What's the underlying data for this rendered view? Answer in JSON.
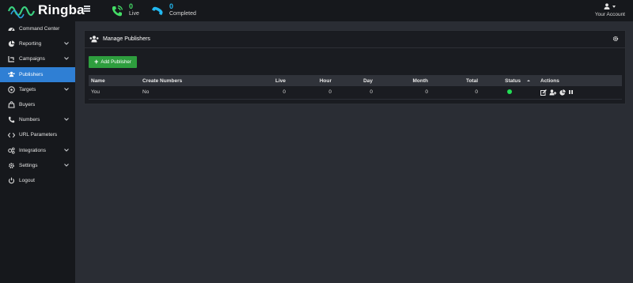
{
  "app": {
    "brand": "Ringba",
    "brand_color": "#3ad07f",
    "accent": "#2f7fd4"
  },
  "topbar": {
    "stats": [
      {
        "value": "0",
        "label": "Live",
        "icon": "phone-live-icon",
        "color": "#44dd66"
      },
      {
        "value": "0",
        "label": "Completed",
        "icon": "phone-completed-icon",
        "color": "#22b8f0"
      }
    ],
    "account_label": "Your Account"
  },
  "sidebar": {
    "items": [
      {
        "label": "Command Center",
        "icon": "dashboard-icon",
        "has_chevron": false,
        "active": false
      },
      {
        "label": "Reporting",
        "icon": "chart-icon",
        "has_chevron": true,
        "active": false
      },
      {
        "label": "Campaigns",
        "icon": "campaign-icon",
        "has_chevron": true,
        "active": false
      },
      {
        "label": "Publishers",
        "icon": "users-icon",
        "has_chevron": false,
        "active": true
      },
      {
        "label": "Targets",
        "icon": "target-icon",
        "has_chevron": true,
        "active": false
      },
      {
        "label": "Buyers",
        "icon": "buyers-icon",
        "has_chevron": false,
        "active": false
      },
      {
        "label": "Numbers",
        "icon": "phone-icon",
        "has_chevron": true,
        "active": false
      },
      {
        "label": "URL Parameters",
        "icon": "code-icon",
        "has_chevron": false,
        "active": false
      },
      {
        "label": "Integrations",
        "icon": "integrations-icon",
        "has_chevron": true,
        "active": false
      },
      {
        "label": "Settings",
        "icon": "gear-icon",
        "has_chevron": true,
        "active": false
      },
      {
        "label": "Logout",
        "icon": "power-icon",
        "has_chevron": false,
        "active": false
      }
    ]
  },
  "panel": {
    "title": "Manage Publishers",
    "add_button": "Add Publisher",
    "columns": [
      "Name",
      "Create Numbers",
      "Live",
      "Hour",
      "Day",
      "Month",
      "Total",
      "Status",
      "Actions"
    ],
    "rows": [
      {
        "name": "You",
        "create_numbers": "No",
        "live": "0",
        "hour": "0",
        "day": "0",
        "month": "0",
        "total": "0",
        "status": "active",
        "status_color": "#22dd55"
      }
    ]
  }
}
